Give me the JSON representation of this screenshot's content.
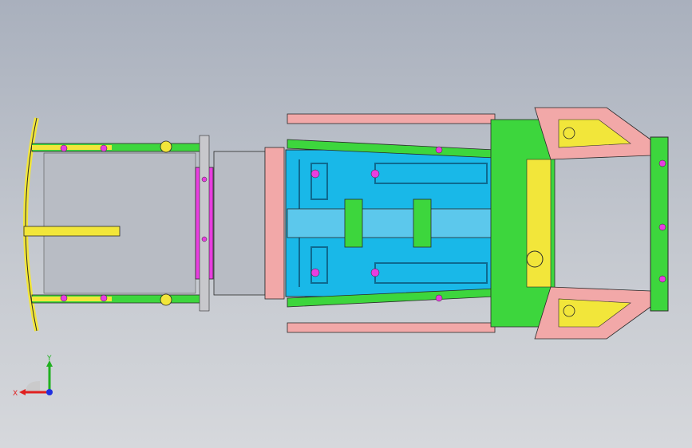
{
  "viewport": {
    "background_top": "#a9b0bd",
    "background_bottom": "#d6d8dc"
  },
  "model": {
    "description_icon": "vehicle-underbody-icon",
    "colors": {
      "cyan": "#19b8e8",
      "green": "#3dd63d",
      "yellow": "#f2e63a",
      "magenta": "#e83ee0",
      "pink": "#f2a8a8",
      "gray": "#b8bcc4",
      "outline": "#2a2a2a"
    }
  },
  "triad": {
    "x_label": "X",
    "y_label": "Y",
    "x_color": "#e02020",
    "y_color": "#20b020",
    "z_color": "#2030e0"
  }
}
